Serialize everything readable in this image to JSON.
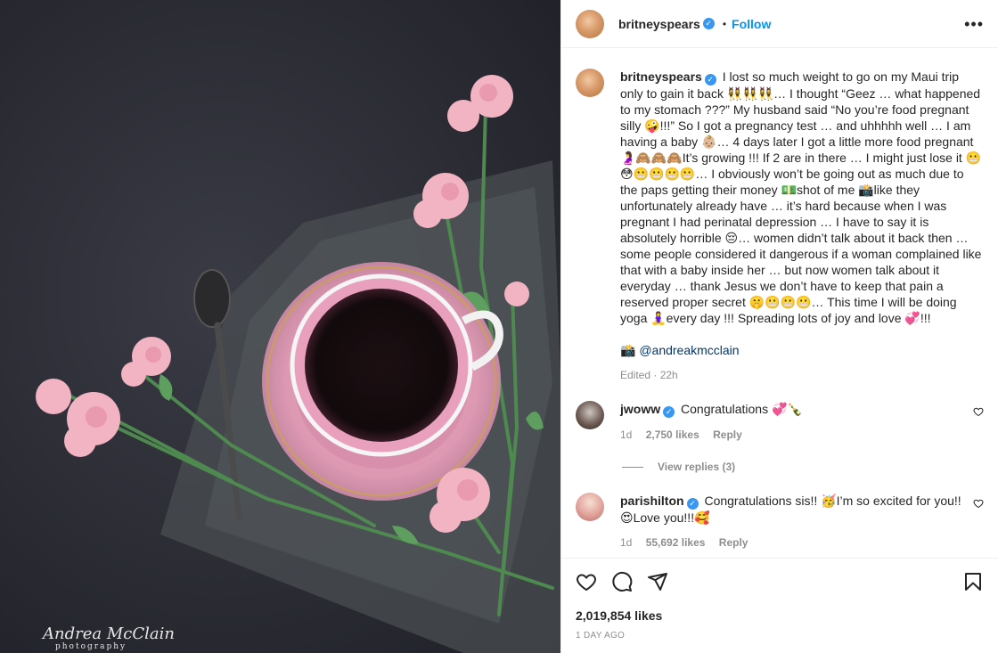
{
  "photo": {
    "watermark": "Andrea McClain",
    "watermark_sub": "photography"
  },
  "post": {
    "username": "britneyspears",
    "follow_label": "Follow",
    "caption": "I lost so much weight to go on my Maui trip only to gain it back 👯‍♀️👯‍♀️👯‍♀️… I thought “Geez … what happened to my stomach ???” My husband said “No you’re food pregnant silly 🤪!!!” So I got a pregnancy test … and uhhhhh well … I am having a baby 👶🏼… 4 days later I got a little more food pregnant 🤰🙈🙈🙈It’s growing !!! If 2 are in there … I might just lose it 😬😳😬😬😬😬… I obviously won’t be going out as much due to the paps getting their money 💵shot of me 📸like they unfortunately already have … it’s hard because when I was pregnant I had perinatal depression … I have to say it is absolutely horrible 😔… women didn’t talk about it back then … some people considered it dangerous if a woman complained like that with a baby inside her … but now women talk about it everyday … thank Jesus we don’t have to keep that pain a reserved proper secret 🤫😬😬😬… This time I will be doing yoga 🧘‍♀️every day !!! Spreading lots of joy and love 💞!!!",
    "credit": "📸 @andreakmcclain",
    "edited": "Edited · 22h",
    "likes": "2,019,854 likes",
    "time": "1 DAY AGO"
  },
  "comments": [
    {
      "username": "jwoww",
      "text": "Congratulations 💞🍾",
      "age": "1d",
      "likes": "2,750 likes",
      "reply": "Reply",
      "view_replies": "View replies (3)"
    },
    {
      "username": "parishilton",
      "text": "Congratulations sis!! 🥳I’m so excited for you!!😍Love you!!!🥰",
      "age": "1d",
      "likes": "55,692 likes",
      "reply": "Reply"
    }
  ]
}
